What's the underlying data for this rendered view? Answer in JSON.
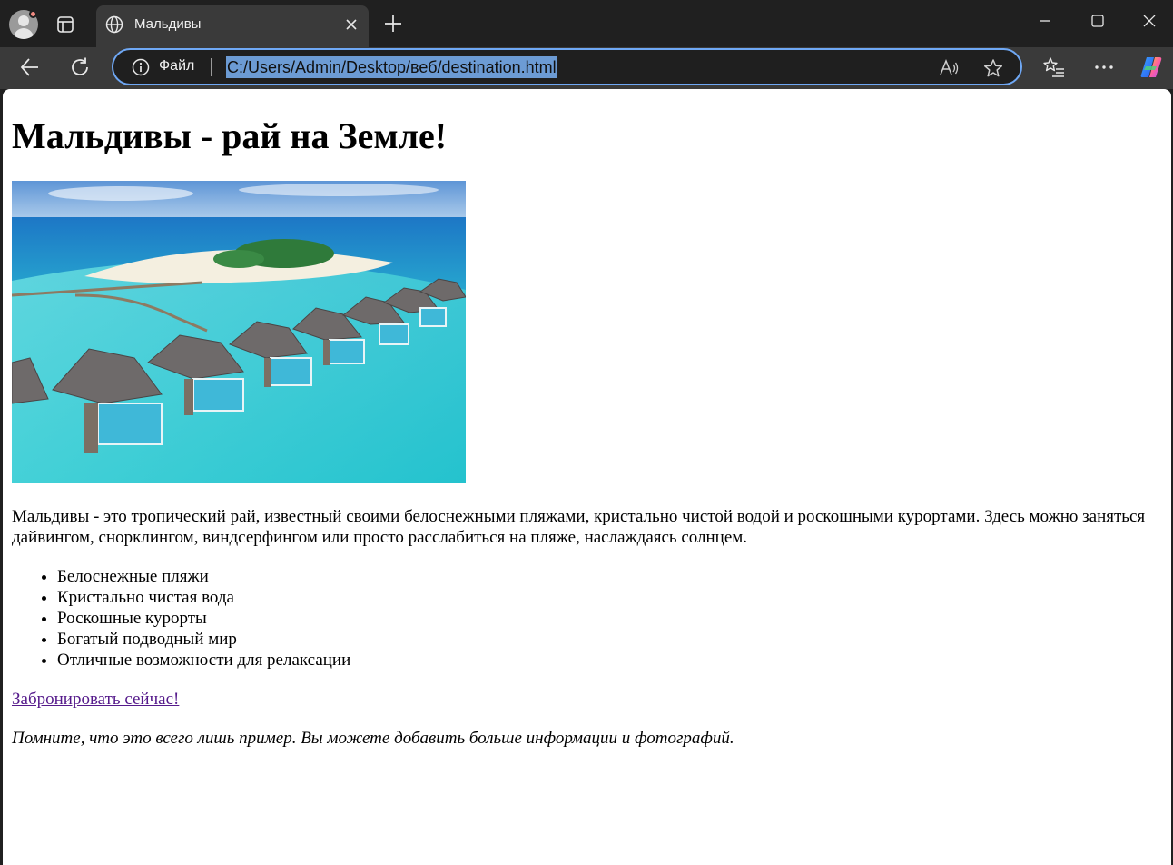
{
  "browser": {
    "tab_title": "Мальдивы",
    "site_label": "Файл",
    "url": "C:/Users/Admin/Desktop/веб/destination.html",
    "colors": {
      "frame": "#202020",
      "toolbar": "#3a3a3a",
      "omnibox_border": "#6fa8f5",
      "url_highlight": "#6c9bd4"
    },
    "icons": {
      "profile": "profile-avatar-icon",
      "tab_actions": "tab-actions-icon",
      "tab_favicon": "globe-icon",
      "close_tab": "close-icon",
      "new_tab": "plus-icon",
      "minimize": "minimize-icon",
      "maximize": "maximize-icon",
      "close_window": "close-icon",
      "back": "back-arrow-icon",
      "refresh": "refresh-icon",
      "info": "info-icon",
      "read_aloud": "read-aloud-icon",
      "favorite": "star-icon",
      "favorites": "favorites-list-icon",
      "more": "more-icon",
      "copilot": "copilot-icon"
    }
  },
  "page": {
    "heading": "Мальдивы - рай на Земле!",
    "description": "Мальдивы - это тропический рай, известный своими белоснежными пляжами, кристально чистой водой и роскошными курортами. Здесь можно заняться дайвингом, снорклингом, виндсерфингом или просто расслабиться на пляже, наслаждаясь солнцем.",
    "features": [
      "Белоснежные пляжи",
      "Кристально чистая вода",
      "Роскошные курорты",
      "Богатый подводный мир",
      "Отличные возможности для релаксации"
    ],
    "book_link": "Забронировать сейчас!",
    "note": "Помните, что это всего лишь пример. Вы можете добавить больше информации и фотографий.",
    "colors": {
      "link_visited": "#551a8b",
      "background": "#ffffff",
      "text": "#000000"
    }
  }
}
